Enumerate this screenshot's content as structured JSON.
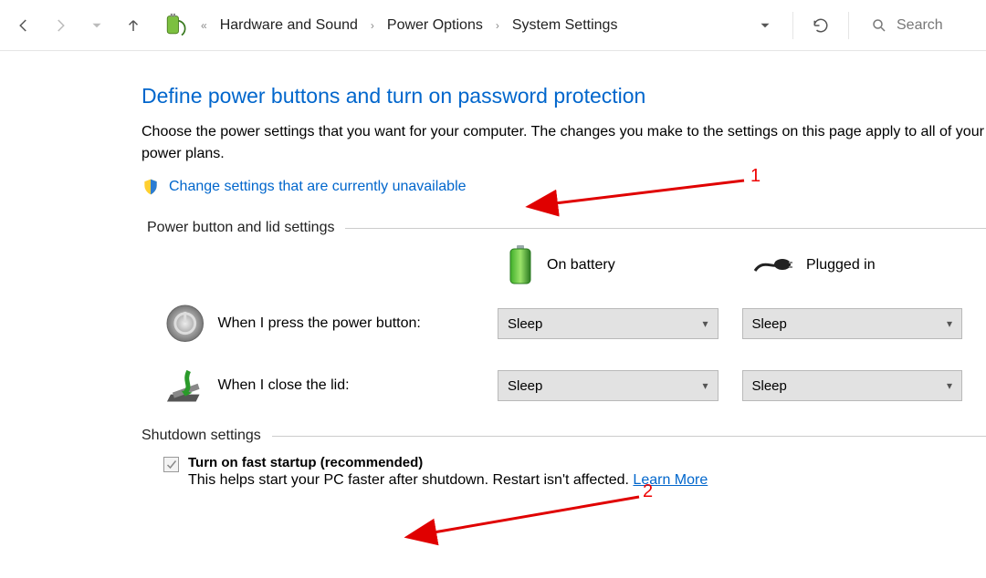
{
  "breadcrumb": {
    "items": [
      "Hardware and Sound",
      "Power Options",
      "System Settings"
    ]
  },
  "search": {
    "placeholder": "Search"
  },
  "page": {
    "title": "Define power buttons and turn on password protection",
    "description": "Choose the power settings that you want for your computer. The changes you make to the settings on this page apply to all of your power plans.",
    "change_link": "Change settings that are currently unavailable"
  },
  "sections": {
    "power_lid_label": "Power button and lid settings",
    "shutdown_label": "Shutdown settings"
  },
  "columns": {
    "battery": "On battery",
    "plugged": "Plugged in"
  },
  "rows": {
    "power_button": {
      "label": "When I press the power button:",
      "battery_value": "Sleep",
      "plugged_value": "Sleep"
    },
    "close_lid": {
      "label": "When I close the lid:",
      "battery_value": "Sleep",
      "plugged_value": "Sleep"
    }
  },
  "shutdown": {
    "fast_startup_label": "Turn on fast startup (recommended)",
    "fast_startup_desc": "This helps start your PC faster after shutdown. Restart isn't affected. ",
    "learn_more": "Learn More",
    "fast_startup_checked": true
  },
  "annotations": {
    "one": "1",
    "two": "2"
  }
}
